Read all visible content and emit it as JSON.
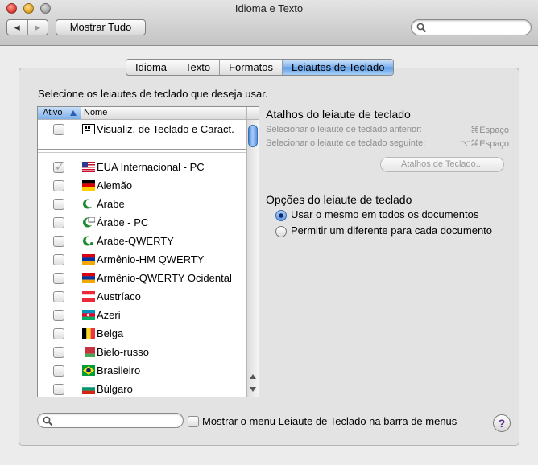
{
  "window": {
    "title": "Idioma e Texto"
  },
  "toolbar": {
    "back_glyph": "◀",
    "forward_glyph": "▶",
    "show_all_label": "Mostrar Tudo",
    "search_value": ""
  },
  "tabs": [
    {
      "label": "Idioma",
      "selected": false
    },
    {
      "label": "Texto",
      "selected": false
    },
    {
      "label": "Formatos",
      "selected": false
    },
    {
      "label": "Leiautes de Teclado",
      "selected": true
    }
  ],
  "instruction": "Selecione os leiautes de teclado que deseja usar.",
  "list": {
    "col_active": "Ativo",
    "col_name": "Nome",
    "rows": [
      {
        "label": "Visualiz. de Teclado e Caract.",
        "checked": false,
        "icon": "keyboard-viewer-icon"
      },
      {
        "label": "EUA Internacional - PC",
        "checked": true,
        "icon": "flag-usa-icon"
      },
      {
        "label": "Alemão",
        "checked": false,
        "icon": "flag-germany-icon"
      },
      {
        "label": "Árabe",
        "checked": false,
        "icon": "crescent-icon"
      },
      {
        "label": "Árabe - PC",
        "checked": false,
        "icon": "crescent-pc-icon"
      },
      {
        "label": "Árabe-QWERTY",
        "checked": false,
        "icon": "crescent-qwerty-icon"
      },
      {
        "label": "Armênio-HM QWERTY",
        "checked": false,
        "icon": "flag-armenia-icon"
      },
      {
        "label": "Armênio-QWERTY Ocidental",
        "checked": false,
        "icon": "flag-armenia-icon"
      },
      {
        "label": "Austríaco",
        "checked": false,
        "icon": "flag-austria-icon"
      },
      {
        "label": "Azeri",
        "checked": false,
        "icon": "flag-azerbaijan-icon"
      },
      {
        "label": "Belga",
        "checked": false,
        "icon": "flag-belgium-icon"
      },
      {
        "label": "Bielo-russo",
        "checked": false,
        "icon": "flag-belarus-icon"
      },
      {
        "label": "Brasileiro",
        "checked": false,
        "icon": "flag-brazil-icon"
      },
      {
        "label": "Búlgaro",
        "checked": false,
        "icon": "flag-bulgaria-icon"
      }
    ]
  },
  "shortcuts": {
    "heading": "Atalhos do leiaute de teclado",
    "previous_label": "Selecionar o leiaute de teclado anterior:",
    "previous_key": "⌘Espaço",
    "next_label": "Selecionar o leiaute de teclado seguinte:",
    "next_key": "⌥⌘Espaço",
    "button_label": "Atalhos de Teclado..."
  },
  "options": {
    "heading": "Opções do leiaute de teclado",
    "same_label": "Usar o mesmo em todos os documentos",
    "different_label": "Permitir um diferente para cada documento",
    "selected": "same"
  },
  "bottom": {
    "search_value": "",
    "show_menu_label": "Mostrar o menu Leiaute de Teclado na barra de menus",
    "show_menu_checked": false,
    "help_glyph": "?"
  },
  "colors": {
    "accent": "#5d9be6",
    "panel": "#e3e3e3",
    "disabled_text": "#8d8d8d"
  }
}
